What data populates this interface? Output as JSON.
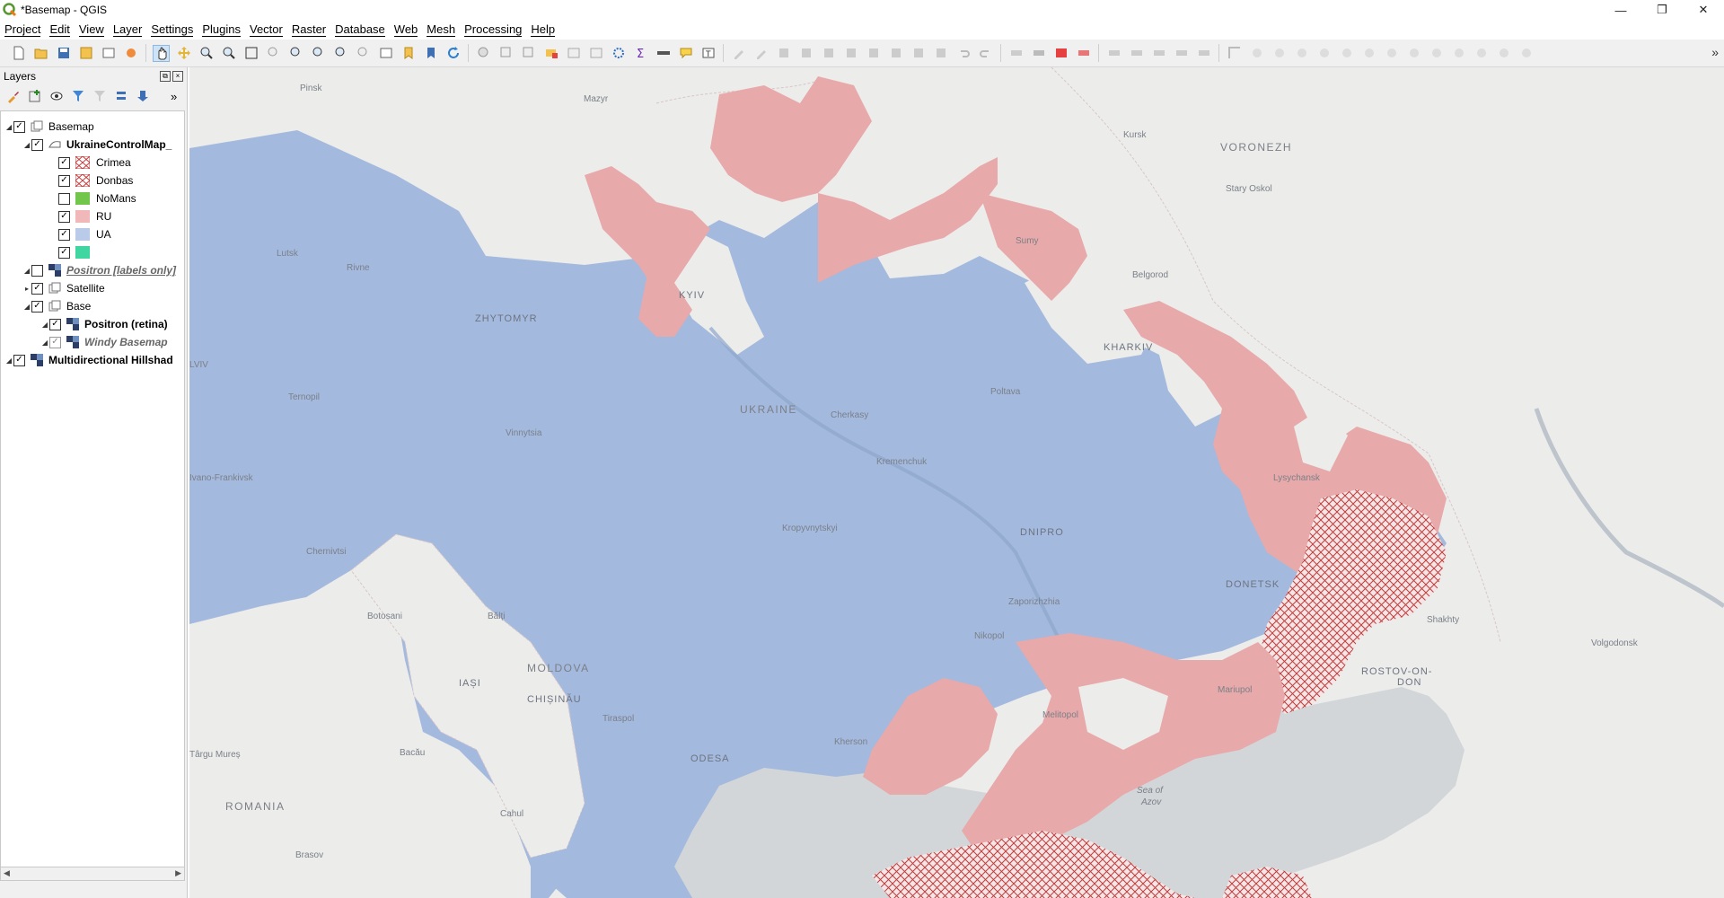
{
  "window": {
    "title": "*Basemap - QGIS",
    "controls": {
      "minimize": "—",
      "maximize": "❐",
      "close": "✕"
    }
  },
  "menu": [
    "Project",
    "Edit",
    "View",
    "Layer",
    "Settings",
    "Plugins",
    "Vector",
    "Raster",
    "Database",
    "Web",
    "Mesh",
    "Processing",
    "Help"
  ],
  "layers_panel": {
    "title": "Layers",
    "tree": [
      {
        "label": "Basemap",
        "checked": true,
        "kind": "group",
        "style": "normal"
      },
      {
        "label": "UkraineControlMap_",
        "checked": true,
        "kind": "vector",
        "style": "bold"
      },
      {
        "label": "Crimea",
        "checked": true,
        "kind": "swatch-hatch",
        "style": "normal"
      },
      {
        "label": "Donbas",
        "checked": true,
        "kind": "swatch-hatch",
        "style": "normal"
      },
      {
        "label": "NoMans",
        "checked": false,
        "kind": "swatch-green",
        "style": "normal"
      },
      {
        "label": "RU",
        "checked": true,
        "kind": "swatch-pink",
        "style": "normal"
      },
      {
        "label": "UA",
        "checked": true,
        "kind": "swatch-blue",
        "style": "normal"
      },
      {
        "label": "",
        "checked": true,
        "kind": "swatch-teal",
        "style": "normal"
      },
      {
        "label": "Positron [labels only]",
        "checked": false,
        "kind": "tile",
        "style": "italic"
      },
      {
        "label": "Satellite",
        "checked": true,
        "kind": "group",
        "style": "normal"
      },
      {
        "label": "Base",
        "checked": true,
        "kind": "group",
        "style": "normal"
      },
      {
        "label": "Positron (retina)",
        "checked": true,
        "kind": "tile",
        "style": "bold"
      },
      {
        "label": "Windy Basemap",
        "checked": true,
        "kind": "tile",
        "style": "italic"
      },
      {
        "label": "Multidirectional Hillshad",
        "checked": true,
        "kind": "raster",
        "style": "bold"
      }
    ]
  },
  "colors": {
    "ua": "#a4b9de",
    "ru": "#e8a9aa",
    "hatch": "#c23c3c",
    "nomans": "#72c64b",
    "teal": "#3fd6a2",
    "sea": "#cfd3d6"
  },
  "map_labels": {
    "pinsk": "Pinsk",
    "mazyr": "Mazyr",
    "kursk": "Kursk",
    "voronezh": "VORONEZH",
    "stary_oskol": "Stary Oskol",
    "lutsk": "Lutsk",
    "rivne": "Rivne",
    "zhytomyr": "ZHYTOMYR",
    "kyiv": "KYIV",
    "sumy": "Sumy",
    "belgorod": "Belgorod",
    "kharkiv": "KHARKIV",
    "lviv": "LVIV",
    "ternopil": "Ternopil",
    "ukraine": "UKRAINE",
    "poltava": "Poltava",
    "cherkasy": "Cherkasy",
    "vinnytsia": "Vinnytsia",
    "kremenchuk": "Kremenchuk",
    "lysychansk": "Lysychansk",
    "ivano": "Ivano-Frankivsk",
    "kropyvnytskyi": "Kropyvnytskyi",
    "dnipro": "DNIPRO",
    "chernivtsi": "Chernivtsi",
    "donetsk": "DONETSK",
    "zaporizhzhia": "Zaporizhzhia",
    "shakhty": "Shakhty",
    "botosani": "Botosani",
    "balti": "Bălți",
    "nikopol": "Nikopol",
    "volgodonsk": "Volgodonsk",
    "moldova": "MOLDOVA",
    "iasi": "IAȘI",
    "chisinau": "CHIȘINĂU",
    "rostov1": "ROSTOV-ON-",
    "rostov2": "DON",
    "mariupol": "Mariupol",
    "tiraspol": "Tiraspol",
    "melitopol": "Melitopol",
    "kherson": "Kherson",
    "targu": "Târgu Mureș",
    "bacau": "Bacău",
    "odesa": "ODESA",
    "sea1": "Sea of",
    "sea2": "Azov",
    "romania": "ROMANIA",
    "cahul": "Cahul",
    "brasov": "Brasov"
  }
}
